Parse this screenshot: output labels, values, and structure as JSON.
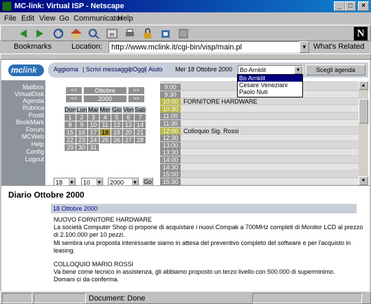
{
  "window": {
    "title": "MC-link: Virtual ISP - Netscape"
  },
  "menu": [
    "File",
    "Edit",
    "View",
    "Go",
    "Communicator",
    "Help"
  ],
  "location": {
    "bookmarks_label": "Bookmarks",
    "location_label": "Location:",
    "url": "http://www.mclink.it/cgi-bin/visp/main.pl",
    "whats_related": "What's Related"
  },
  "header": {
    "nav": [
      "Aggiorna",
      "Scrivi messaggio",
      "Oggi",
      "Aiuto"
    ],
    "date": "Mer 18 Ottobre 2000",
    "user_selected": "Bo Arnklit",
    "agenda_button": "Scegli agenda"
  },
  "user_options": [
    "Bo Arnklit",
    "Cesare Veneziani",
    "Paolo Nuti"
  ],
  "sidebar": [
    "Mailbox",
    "VirtualDisk",
    "Agenda",
    "Rubrica",
    "Postit",
    "BookMark",
    "Forum",
    "MCWeb",
    "Help",
    "Config",
    "Logout"
  ],
  "calendar": {
    "prev": "<<",
    "next": ">>",
    "month": "Ottobre",
    "year": "2000",
    "weekdays": [
      "Dom",
      "Lun",
      "Mar",
      "Mer",
      "Gio",
      "Ven",
      "Sab"
    ],
    "weeks": [
      [
        "1",
        "2",
        "3",
        "4",
        "5",
        "6",
        "7"
      ],
      [
        "8",
        "9",
        "10",
        "11",
        "12",
        "13",
        "14"
      ],
      [
        "15",
        "16",
        "17",
        "18",
        "19",
        "20",
        "21"
      ],
      [
        "22",
        "23",
        "24",
        "25",
        "26",
        "27",
        "28"
      ],
      [
        "29",
        "30",
        "31",
        "",
        "",
        "",
        ""
      ]
    ],
    "today": "18",
    "day_select": "18",
    "month_select": "10",
    "year_select": "2000",
    "go_label": "Go"
  },
  "schedule": [
    {
      "time": "9:00",
      "event": "",
      "busy": false
    },
    {
      "time": "9:30",
      "event": "",
      "busy": false
    },
    {
      "time": "10:00",
      "event": "FORNITORE HARDWARE",
      "busy": true
    },
    {
      "time": "10:30",
      "event": "",
      "busy": true
    },
    {
      "time": "11:00",
      "event": "",
      "busy": false
    },
    {
      "time": "11:30",
      "event": "",
      "busy": false
    },
    {
      "time": "12:00",
      "event": "Colloquio Sig. Rossi",
      "busy": true
    },
    {
      "time": "12:30",
      "event": "",
      "busy": false
    },
    {
      "time": "13:00",
      "event": "",
      "busy": false
    },
    {
      "time": "13:30",
      "event": "",
      "busy": false
    },
    {
      "time": "14:00",
      "event": "",
      "busy": false
    },
    {
      "time": "14:30",
      "event": "",
      "busy": false
    },
    {
      "time": "15:00",
      "event": "",
      "busy": false
    },
    {
      "time": "15:30",
      "event": "",
      "busy": false
    }
  ],
  "diary": {
    "title": "Diario Ottobre 2000",
    "date": "18 Ottobre 2000",
    "entry1_title": "NUOVO FORNITORE HARDWARE",
    "entry1_line1": "La società Computer Shop ci propone di acquistare i nuovi Compak a 700MHz completi di Monitor LCD al prezzo",
    "entry1_line2": "di 2.100.000 per 10 pezzi.",
    "entry1_line3": "Mi sembra una proposta interessante siamo in attesa del preventivo completo del software e per l'acquisto in",
    "entry1_line4": "leasing.",
    "entry2_title": "COLLOQUIO MARIO ROSSI",
    "entry2_line1": "Va bene come tecnico in assistenza, gli abbiamo proposto un terzo livello con 500.000 di superminimo.",
    "entry2_line2": "Domani ci da conferma."
  },
  "status": {
    "text": "Document: Done"
  }
}
